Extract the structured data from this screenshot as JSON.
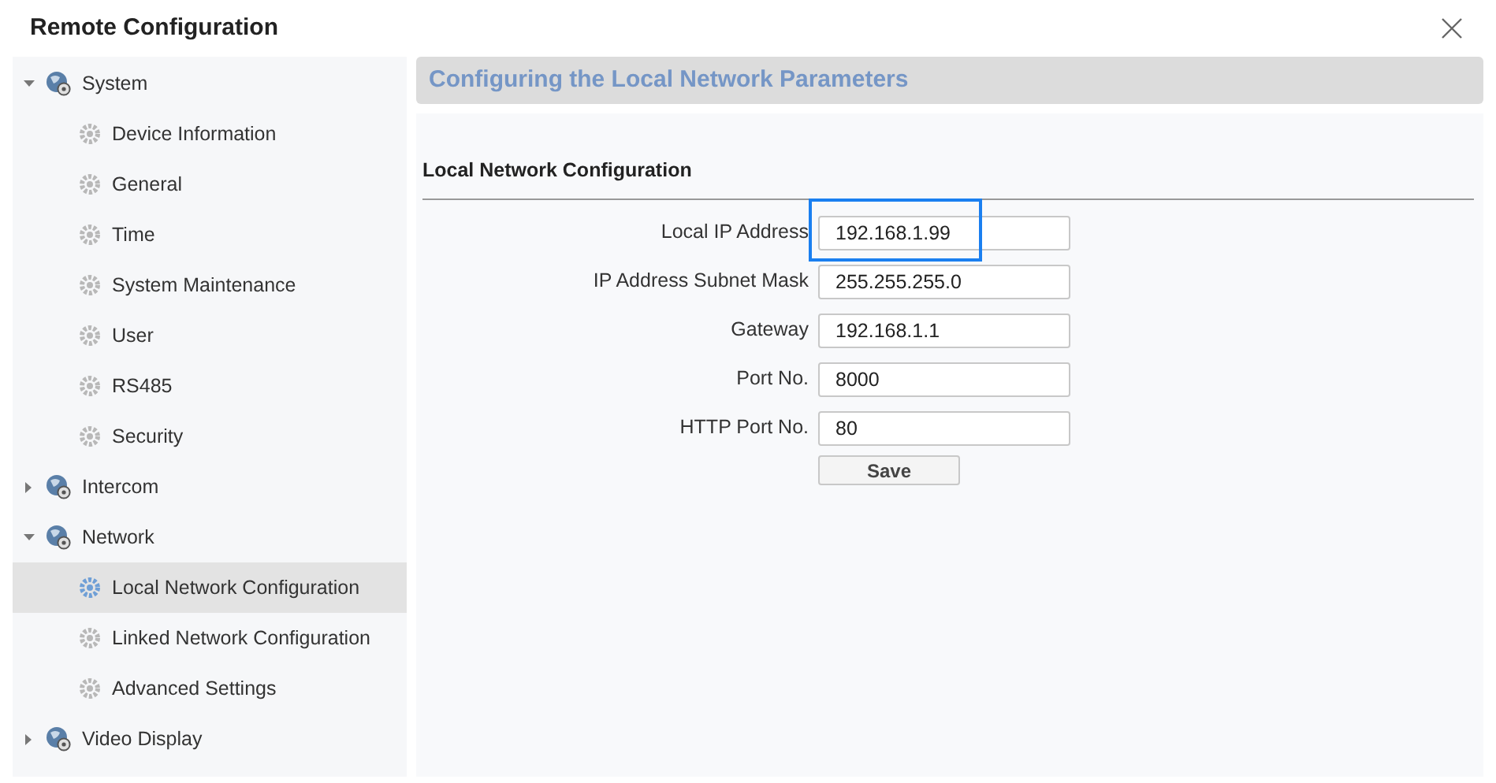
{
  "window": {
    "title": "Remote Configuration"
  },
  "sidebar": {
    "items": [
      {
        "label": "System",
        "expanded": true,
        "children": [
          {
            "label": "Device Information",
            "selected": false
          },
          {
            "label": "General",
            "selected": false
          },
          {
            "label": "Time",
            "selected": false
          },
          {
            "label": "System Maintenance",
            "selected": false
          },
          {
            "label": "User",
            "selected": false
          },
          {
            "label": "RS485",
            "selected": false
          },
          {
            "label": "Security",
            "selected": false
          }
        ]
      },
      {
        "label": "Intercom",
        "expanded": false
      },
      {
        "label": "Network",
        "expanded": true,
        "children": [
          {
            "label": "Local Network Configuration",
            "selected": true
          },
          {
            "label": "Linked Network Configuration",
            "selected": false
          },
          {
            "label": "Advanced Settings",
            "selected": false
          }
        ]
      },
      {
        "label": "Video Display",
        "expanded": false
      }
    ]
  },
  "panel": {
    "title": "Configuring the Local Network Parameters",
    "section": "Local Network Configuration",
    "fields": [
      {
        "label": "Local IP Address",
        "value": "192.168.1.99",
        "highlighted": true
      },
      {
        "label": "IP Address Subnet Mask",
        "value": "255.255.255.0",
        "highlighted": false
      },
      {
        "label": "Gateway",
        "value": "192.168.1.1",
        "highlighted": false
      },
      {
        "label": "Port No.",
        "value": "8000",
        "highlighted": false
      },
      {
        "label": "HTTP Port No.",
        "value": "80",
        "highlighted": false
      }
    ],
    "save_button": "Save"
  }
}
